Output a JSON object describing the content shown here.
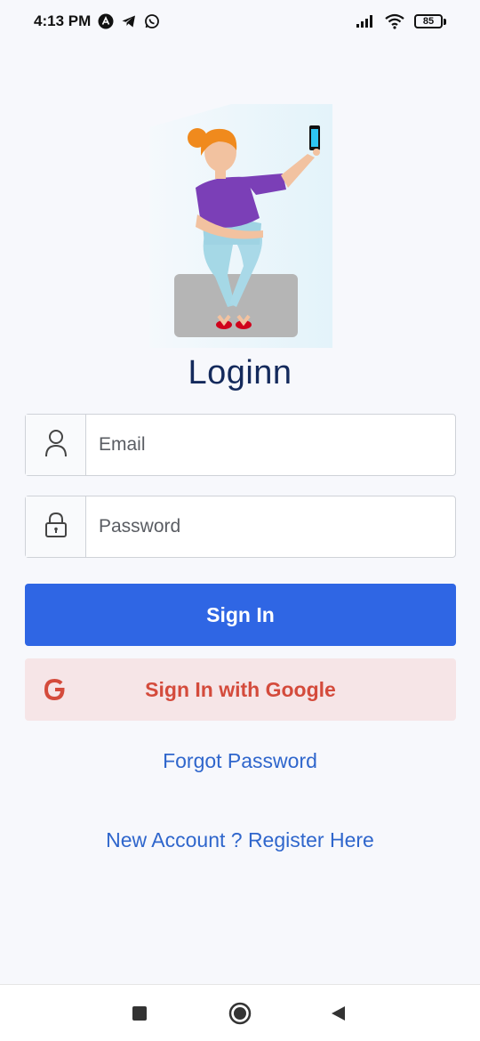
{
  "status_bar": {
    "time": "4:13 PM",
    "battery": "85",
    "notification_icons": [
      "app-icon",
      "telegram-icon",
      "whatsapp-icon"
    ],
    "system_icons": [
      "signal-icon",
      "wifi-icon",
      "battery-icon"
    ]
  },
  "login": {
    "title": "Loginn",
    "email_placeholder": "Email",
    "email_value": "",
    "password_placeholder": "Password",
    "password_value": "",
    "sign_in_label": "Sign In",
    "google_label": "Sign In with Google",
    "forgot_password_label": "Forgot Password",
    "register_label": "New Account ? Register Here"
  },
  "colors": {
    "primary": "#2f66e4",
    "google_bg": "#f6e5e7",
    "google_text": "#d44b3c",
    "link": "#2f66cc",
    "title": "#142a5c",
    "background": "#f7f8fc"
  },
  "nav_bar": {
    "buttons": [
      "recents-square-icon",
      "home-circle-icon",
      "back-triangle-icon"
    ]
  }
}
